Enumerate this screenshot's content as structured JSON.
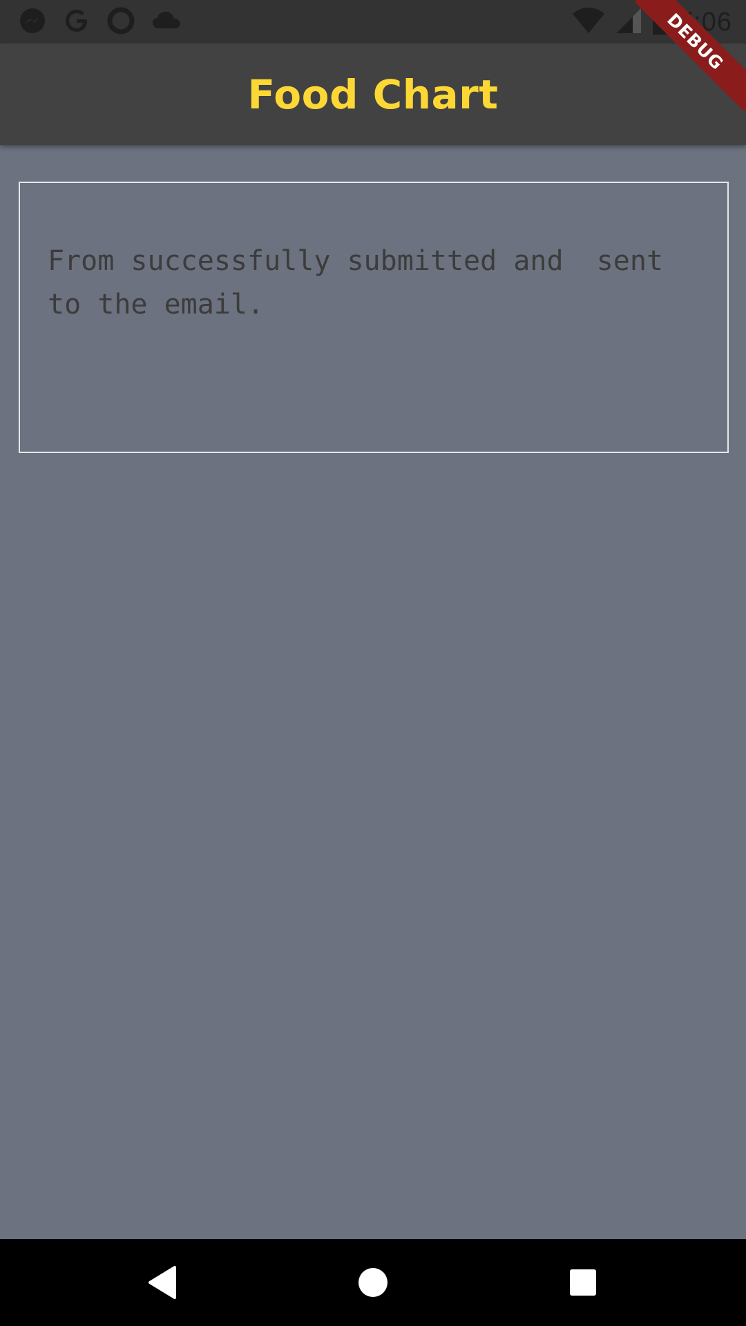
{
  "status_bar": {
    "time": "7:06",
    "left_icons": [
      "messenger-icon",
      "google-icon",
      "circle-icon",
      "cloud-icon"
    ],
    "right_icons": [
      "wifi-icon",
      "signal-icon",
      "battery-icon"
    ]
  },
  "app_bar": {
    "title": "Food Chart",
    "title_color": "#fdd835",
    "background": "#424242"
  },
  "debug_banner": {
    "label": "DEBUG"
  },
  "content": {
    "message": "From successfully submitted and  sent to the email.",
    "background": "#6c727f"
  },
  "nav_bar": {
    "buttons": [
      "back-icon",
      "home-icon",
      "recents-icon"
    ]
  }
}
